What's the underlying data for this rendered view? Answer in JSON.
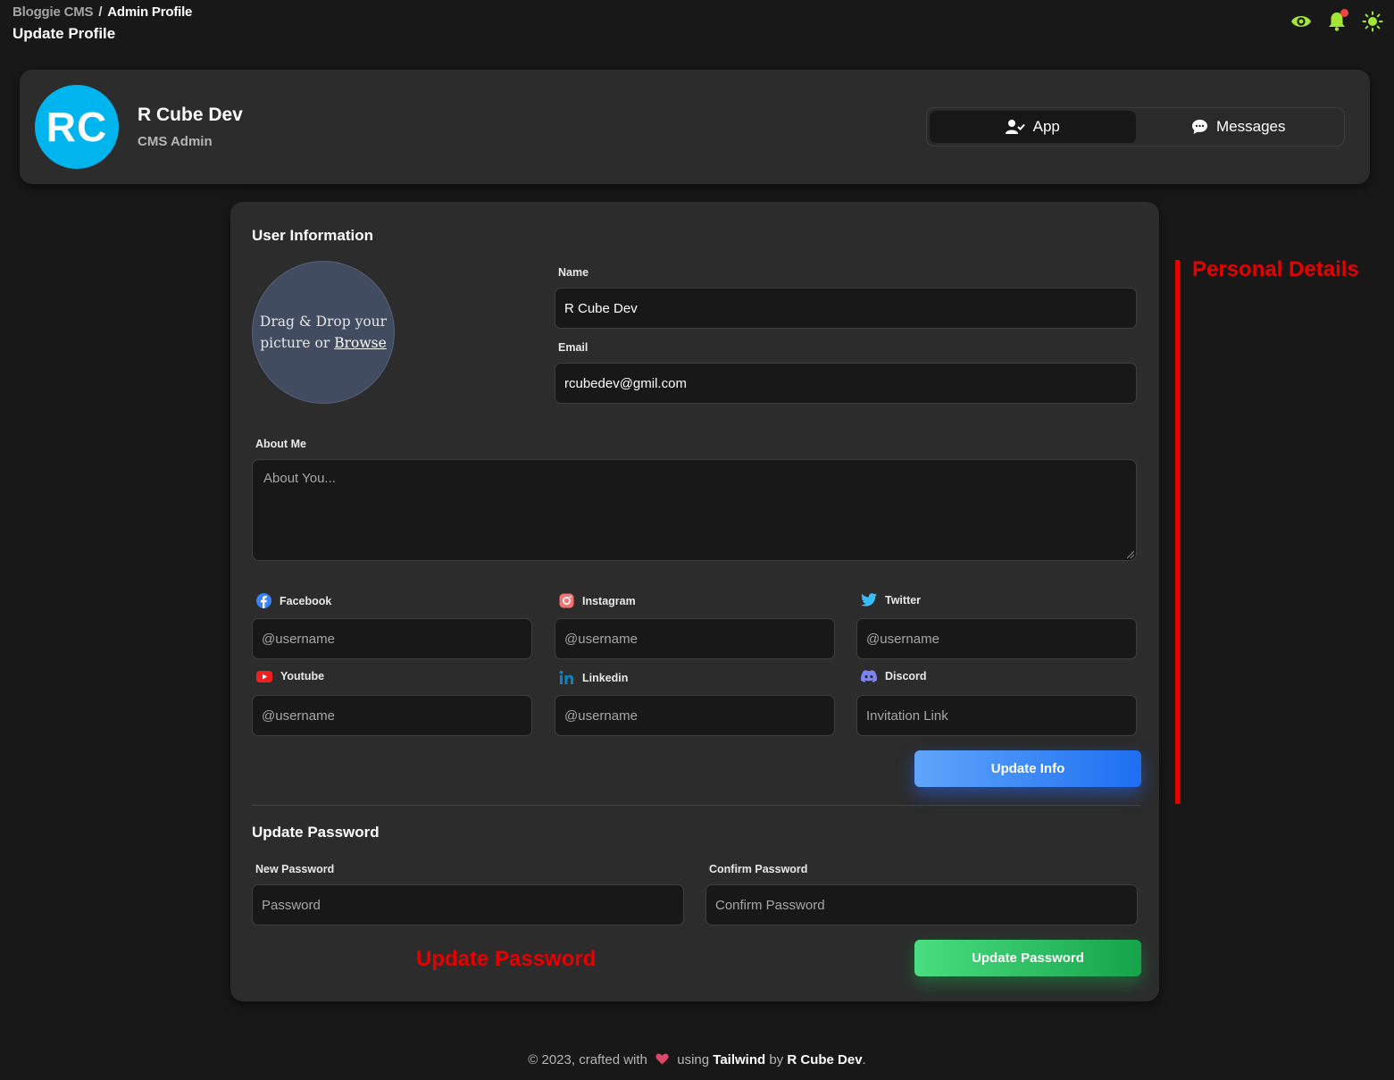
{
  "breadcrumb": {
    "root": "Bloggie CMS",
    "separator": "/",
    "current": "Admin Profile"
  },
  "page_title": "Update Profile",
  "profile": {
    "initials": "RC",
    "name": "R Cube Dev",
    "role": "CMS Admin",
    "avatar_color": "#00b4ee"
  },
  "tabs": [
    {
      "label": "App",
      "active": true
    },
    {
      "label": "Messages",
      "active": false
    }
  ],
  "user_info": {
    "title": "User Information",
    "dropzone": {
      "text": "Drag & Drop your picture or",
      "link": "Browse"
    },
    "name": {
      "label": "Name",
      "value": "R Cube Dev"
    },
    "email": {
      "label": "Email",
      "value": "rcubedev@gmil.com"
    },
    "about": {
      "label": "About Me",
      "placeholder": "About You..."
    }
  },
  "socials": [
    {
      "label": "Facebook",
      "placeholder": "@username",
      "icon": "facebook-icon",
      "color": "#3b82f6"
    },
    {
      "label": "Instagram",
      "placeholder": "@username",
      "icon": "instagram-icon",
      "color": "#f87171"
    },
    {
      "label": "Twitter",
      "placeholder": "@username",
      "icon": "twitter-icon",
      "color": "#38bdf8"
    },
    {
      "label": "Youtube",
      "placeholder": "@username",
      "icon": "youtube-icon",
      "color": "#ef2020"
    },
    {
      "label": "Linkedin",
      "placeholder": "@username",
      "icon": "linkedin-icon",
      "color": "#0a83c9"
    },
    {
      "label": "Discord",
      "placeholder": "Invitation Link",
      "icon": "discord-icon",
      "color": "#7c83f5"
    }
  ],
  "update_info_button": "Update Info",
  "password": {
    "title": "Update Password",
    "new": {
      "label": "New Password",
      "placeholder": "Password"
    },
    "confirm": {
      "label": "Confirm Password",
      "placeholder": "Confirm Password"
    },
    "button": "Update Password"
  },
  "annotations": {
    "personal_details": "Personal Details",
    "update_password": "Update Password"
  },
  "footer": {
    "prefix": "© 2023, crafted with",
    "middle": "using",
    "tech": "Tailwind",
    "by": "by",
    "author": "R Cube Dev",
    "suffix": "."
  },
  "colors": {
    "accent_green": "#a3e635",
    "info_button": "#1d6ff2",
    "password_button": "#16a34a",
    "annotation": "#e60000"
  }
}
